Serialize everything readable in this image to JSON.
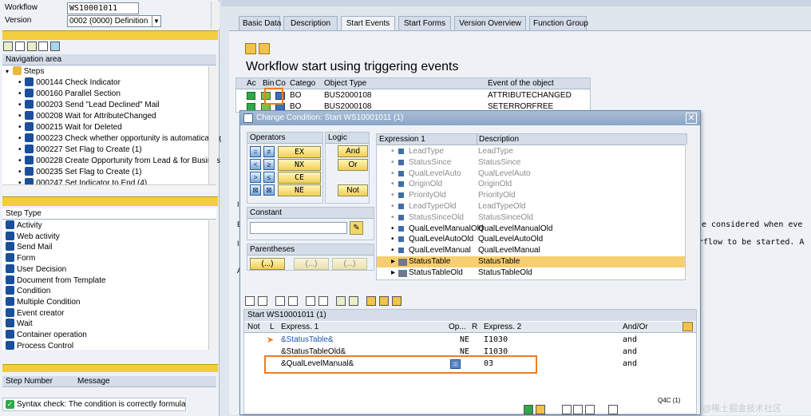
{
  "header": {
    "workflow_label": "Workflow",
    "workflow_value": "WS10001011",
    "version_label": "Version",
    "version_value": "0002 (0000) Definition"
  },
  "nav": {
    "title": "Navigation area",
    "steps_label": "Steps",
    "items": [
      "000144 Check Indicator",
      "000160 Parallel Section",
      "000203 Send \"Lead Declined\" Mail",
      "000208 Wait for AttributeChanged",
      "000215 Wait for Deleted",
      "000223 Check whether opportunity is automatically g",
      "000227 Set Flag to Create (1)",
      "000228 Create Opportunity from Lead & for Busines",
      "000235 Set Flag to Create (1)",
      "000247 Set Indicator to End (4)"
    ]
  },
  "step_type": {
    "title": "Step Type",
    "items": [
      "Activity",
      "Web activity",
      "Send Mail",
      "Form",
      "User Decision",
      "Document from Template",
      "Condition",
      "Multiple Condition",
      "Event creator",
      "Wait",
      "Container operation",
      "Process Control"
    ]
  },
  "bottom": {
    "col1": "Step Number",
    "col2": "Message",
    "status": "Syntax check: The condition is correctly formulated"
  },
  "tabs": [
    "Basic Data",
    "Description",
    "Start Events",
    "Start Forms",
    "Version Overview",
    "Function Group"
  ],
  "main": {
    "title": "Workflow start using triggering events",
    "cols": [
      "Ac",
      "Bin",
      "Co",
      "Catego",
      "Object Type",
      "Event of the object"
    ],
    "rows": [
      {
        "cat": "BO",
        "obj": "BUS2000108",
        "event": "ATTRIBUTECHANGED"
      },
      {
        "cat": "BO",
        "obj": "BUS2000108",
        "event": "SETERRORFREE"
      }
    ],
    "bg_text1": "e considered when eve",
    "bg_text2": "rflow to be started. A"
  },
  "dialog": {
    "title": "Change Condition: Start WS10001011 (1)",
    "operators_label": "Operators",
    "logic_label": "Logic",
    "ops": [
      "EX",
      "NX",
      "CE",
      "NE"
    ],
    "logic": [
      "And",
      "Or",
      "Not"
    ],
    "constant_label": "Constant",
    "parentheses_label": "Parentheses",
    "paren_btn": "(...)",
    "expr_cols": [
      "Expression 1",
      "Description"
    ],
    "expr_rows": [
      [
        "LeadType",
        "LeadType"
      ],
      [
        "StatusSince",
        "StatusSince"
      ],
      [
        "QualLevelAuto",
        "QualLevelAuto"
      ],
      [
        "OriginOld",
        "OriginOld"
      ],
      [
        "PriorityOld",
        "PriorityOld"
      ],
      [
        "LeadTypeOld",
        "LeadTypeOld"
      ],
      [
        "StatusSinceOld",
        "StatusSinceOld"
      ],
      [
        "QualLevelManualOld",
        "QualLevelManualOld"
      ],
      [
        "QualLevelAutoOld",
        "QualLevelAutoOld"
      ],
      [
        "QualLevelManual",
        "QualLevelManual"
      ],
      [
        "StatusTable",
        "StatusTable"
      ],
      [
        "StatusTableOld",
        "StatusTableOld"
      ]
    ],
    "cond_title": "Start WS10001011 (1)",
    "cond_cols": [
      "Not",
      "L",
      "Express. 1",
      "Op...",
      "R",
      "Express. 2",
      "And/Or"
    ],
    "cond_rows": [
      {
        "e1": "&StatusTable&",
        "op": "NE",
        "e2": "I1030",
        "andor": "and"
      },
      {
        "e1": "&StatusTableOld&",
        "op": "NE",
        "e2": "I1030",
        "andor": "and"
      },
      {
        "e1": "&QualLevelManual&",
        "op": "",
        "e2": "03",
        "andor": "and"
      }
    ]
  },
  "watermark": "@稀土掘金技术社区",
  "corner": "Q4C (1)",
  "colors": {
    "accent": "#f07b23",
    "nav_bg": "#eef2f7",
    "dialog_title": "#8aa6c7",
    "highlight": "#f7cf70"
  }
}
